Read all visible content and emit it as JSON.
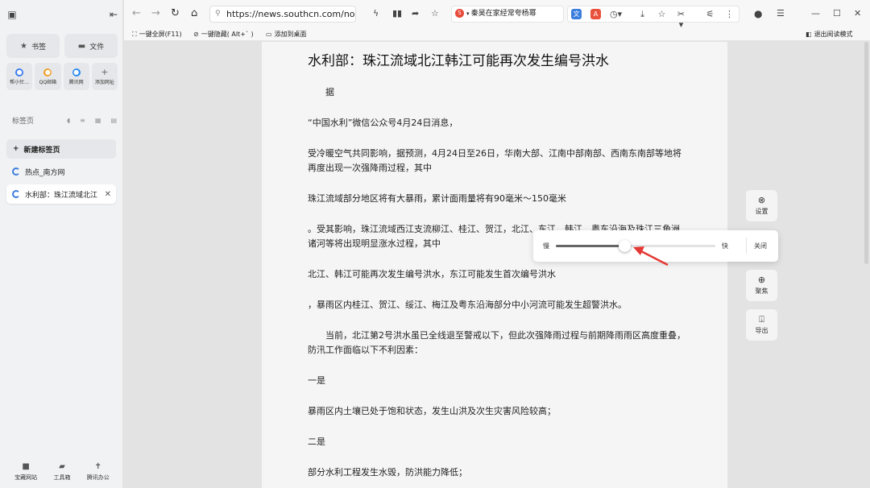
{
  "sidebar": {
    "bookmarks_label": "书签",
    "files_label": "文件",
    "apps": [
      {
        "label": "帮小忙…",
        "icon": "bangxiaomang-icon",
        "color": "#3a7bf0"
      },
      {
        "label": "QQ邮箱",
        "icon": "qq-mail-icon",
        "color": "#f0a02a"
      },
      {
        "label": "腾讯网",
        "icon": "qq-news-icon",
        "color": "#2a8af0"
      },
      {
        "label": "添加网址",
        "icon": "plus-icon",
        "color": "#888888"
      }
    ],
    "tabs_header": "标签页",
    "new_tab_label": "新建标签页",
    "tabs": [
      {
        "title": "热点_南方网",
        "active": false
      },
      {
        "title": "水利部：珠江流域北江",
        "active": true
      }
    ],
    "bottom": [
      {
        "label": "宝藏网站",
        "icon": "treasure-icon"
      },
      {
        "label": "工具箱",
        "icon": "toolbox-icon"
      },
      {
        "label": "腾讯办公",
        "icon": "office-icon"
      }
    ]
  },
  "toolbar": {
    "url": "https://news.southcn.com/node_",
    "hot_search": "秦昊在家经常夸杨幂",
    "accent": "#3b7ddd"
  },
  "bookmark_bar": {
    "fullscreen": "一键全屏(F11)",
    "hide": "一键隐藏( Alt+` )",
    "add_desktop": "添加到桌面",
    "exit_reader": "退出阅读模式"
  },
  "article": {
    "title": "水利部：珠江流域北江韩江可能再次发生编号洪水",
    "paragraphs": [
      {
        "text": "据",
        "indent": true
      },
      {
        "text": "“中国水利”微信公众号4月24日消息，",
        "indent": false
      },
      {
        "text": "受冷暖空气共同影响，据预测，4月24日至26日，华南大部、江南中部南部、西南东南部等地将再度出现一次强降雨过程，其中",
        "indent": false
      },
      {
        "text": "珠江流域部分地区将有大暴雨，累计面雨量将有90毫米～150毫米",
        "indent": false
      },
      {
        "text": "。受其影响，珠江流域西江支流柳江、桂江、贺江，北江、东江、韩江、粤东沿海及珠江三角洲诸河等将出现明显涨水过程，其中",
        "indent": false
      },
      {
        "text": "北江、韩江可能再次发生编号洪水，东江可能发生首次编号洪水",
        "indent": false
      },
      {
        "text": "，暴雨区内桂江、贺江、绥江、梅江及粤东沿海部分中小河流可能发生超警洪水。",
        "indent": false
      },
      {
        "text": "当前，北江第2号洪水虽已全线退至警戒以下，但此次强降雨过程与前期降雨雨区高度重叠，防汛工作面临以下不利因素：",
        "indent": true
      },
      {
        "text": "一是",
        "indent": false
      },
      {
        "text": "暴雨区内土壤已处于饱和状态，发生山洪及次生灾害风险较高；",
        "indent": false
      },
      {
        "text": "二是",
        "indent": false
      },
      {
        "text": "部分水利工程发生水毁，防洪能力降低；",
        "indent": false
      }
    ]
  },
  "reader_controls": {
    "settings_label": "设置",
    "focus_label": "聚焦",
    "export_label": "导出"
  },
  "speed_panel": {
    "slow_label": "慢",
    "fast_label": "快",
    "close_label": "关闭",
    "value": 0.43
  }
}
